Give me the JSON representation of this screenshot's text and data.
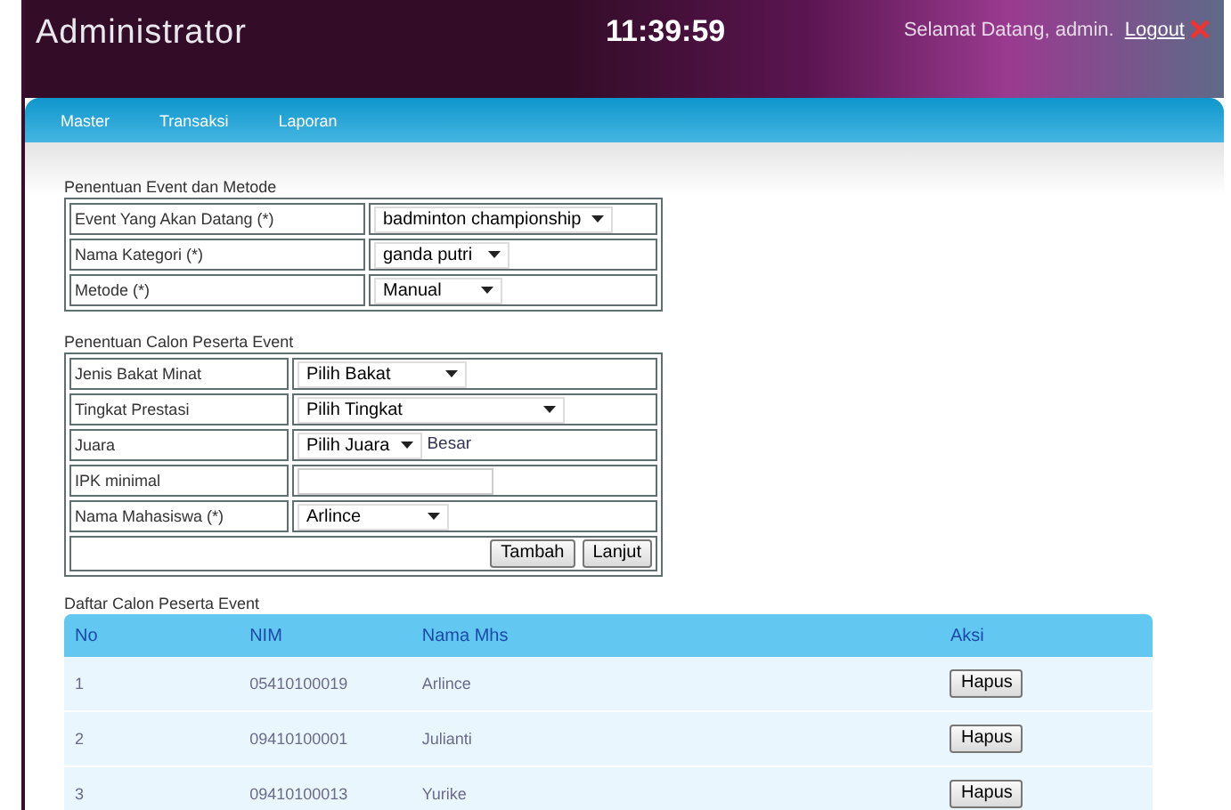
{
  "header": {
    "title": "Administrator",
    "clock": "11:39:59",
    "greeting": "Selamat Datang, admin.",
    "logout": "Logout"
  },
  "nav": [
    {
      "label": "Master"
    },
    {
      "label": "Transaksi"
    },
    {
      "label": "Laporan"
    }
  ],
  "event_form": {
    "title": "Penentuan Event dan Metode",
    "rows": [
      {
        "label": "Event Yang Akan Datang (*)",
        "kind": "select",
        "value": "badminton championship"
      },
      {
        "label": "Nama Kategori (*)",
        "kind": "select",
        "value": "ganda putri"
      },
      {
        "label": "Metode (*)",
        "kind": "select",
        "value": "Manual"
      }
    ]
  },
  "candidate_form": {
    "title": "Penentuan Calon Peserta Event",
    "rows": [
      {
        "label": "Jenis Bakat Minat",
        "kind": "select",
        "value": "Pilih Bakat"
      },
      {
        "label": "Tingkat Prestasi",
        "kind": "select",
        "value": "Pilih Tingkat"
      },
      {
        "label": "Juara",
        "kind": "select",
        "value": "Pilih Juara",
        "suffix": "Besar"
      },
      {
        "label": "IPK minimal",
        "kind": "input"
      },
      {
        "label": "Nama Mahasiswa (*)",
        "kind": "select",
        "value": "Arlince"
      }
    ],
    "buttons": [
      "Tambah",
      "Lanjut"
    ]
  },
  "list": {
    "title": "Daftar Calon Peserta Event",
    "columns": [
      "No",
      "NIM",
      "Nama Mhs",
      "Aksi"
    ],
    "rows": [
      {
        "no": "1",
        "nim": "05410100019",
        "name": "Arlince",
        "action": "Hapus"
      },
      {
        "no": "2",
        "nim": "09410100001",
        "name": "Julianti",
        "action": "Hapus"
      },
      {
        "no": "3",
        "nim": "09410100013",
        "name": "Yurike",
        "action": "Hapus"
      }
    ]
  }
}
